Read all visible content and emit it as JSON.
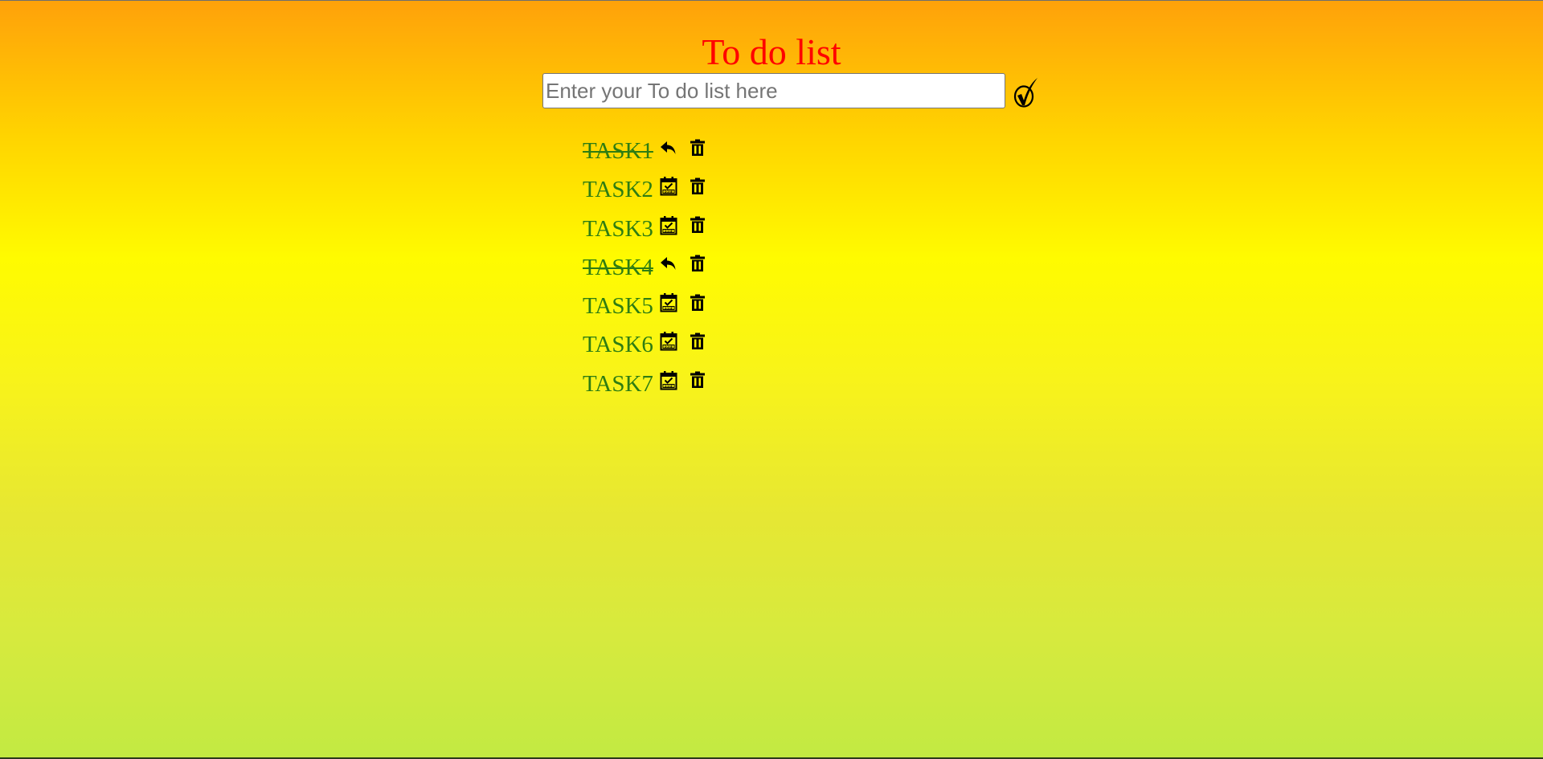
{
  "app": {
    "title": "To do list"
  },
  "input": {
    "placeholder": "Enter your To do list here",
    "value": ""
  },
  "icons": {
    "add": "check-circle-icon",
    "done": "calendar-done-icon",
    "undo": "undo-arrow-icon",
    "delete": "trash-icon"
  },
  "colors": {
    "title": "#ff0000",
    "task_text": "#2e7d12",
    "icon": "#000000"
  },
  "tasks": [
    {
      "label": "TASK1",
      "done": true
    },
    {
      "label": "TASK2",
      "done": false
    },
    {
      "label": "TASK3",
      "done": false
    },
    {
      "label": "TASK4",
      "done": true
    },
    {
      "label": "TASK5",
      "done": false
    },
    {
      "label": "TASK6",
      "done": false
    },
    {
      "label": "TASK7",
      "done": false
    }
  ]
}
